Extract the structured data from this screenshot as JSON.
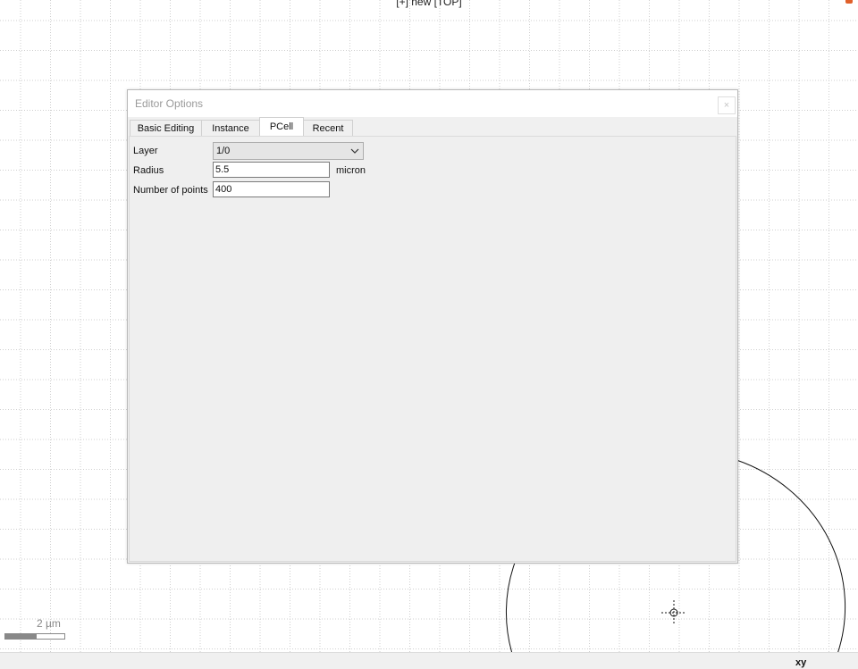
{
  "window": {
    "title": "[+] new [TOP]"
  },
  "canvas": {
    "scalebar_label": "2  µm",
    "coord_mode": "xy"
  },
  "dialog": {
    "title": "Editor Options",
    "close_label": "×",
    "tabs": [
      {
        "label": "Basic Editing",
        "active": false
      },
      {
        "label": "Instance",
        "active": false
      },
      {
        "label": "PCell",
        "active": true
      },
      {
        "label": "Recent",
        "active": false
      }
    ],
    "fields": {
      "layer": {
        "label": "Layer",
        "value": "1/0"
      },
      "radius": {
        "label": "Radius",
        "value": "5.5",
        "unit": "micron"
      },
      "points": {
        "label": "Number of points",
        "value": "400"
      }
    }
  },
  "icons": {
    "close": "close-icon",
    "chevron": "chevron-down-icon",
    "crosshair": "crosshair-icon"
  }
}
